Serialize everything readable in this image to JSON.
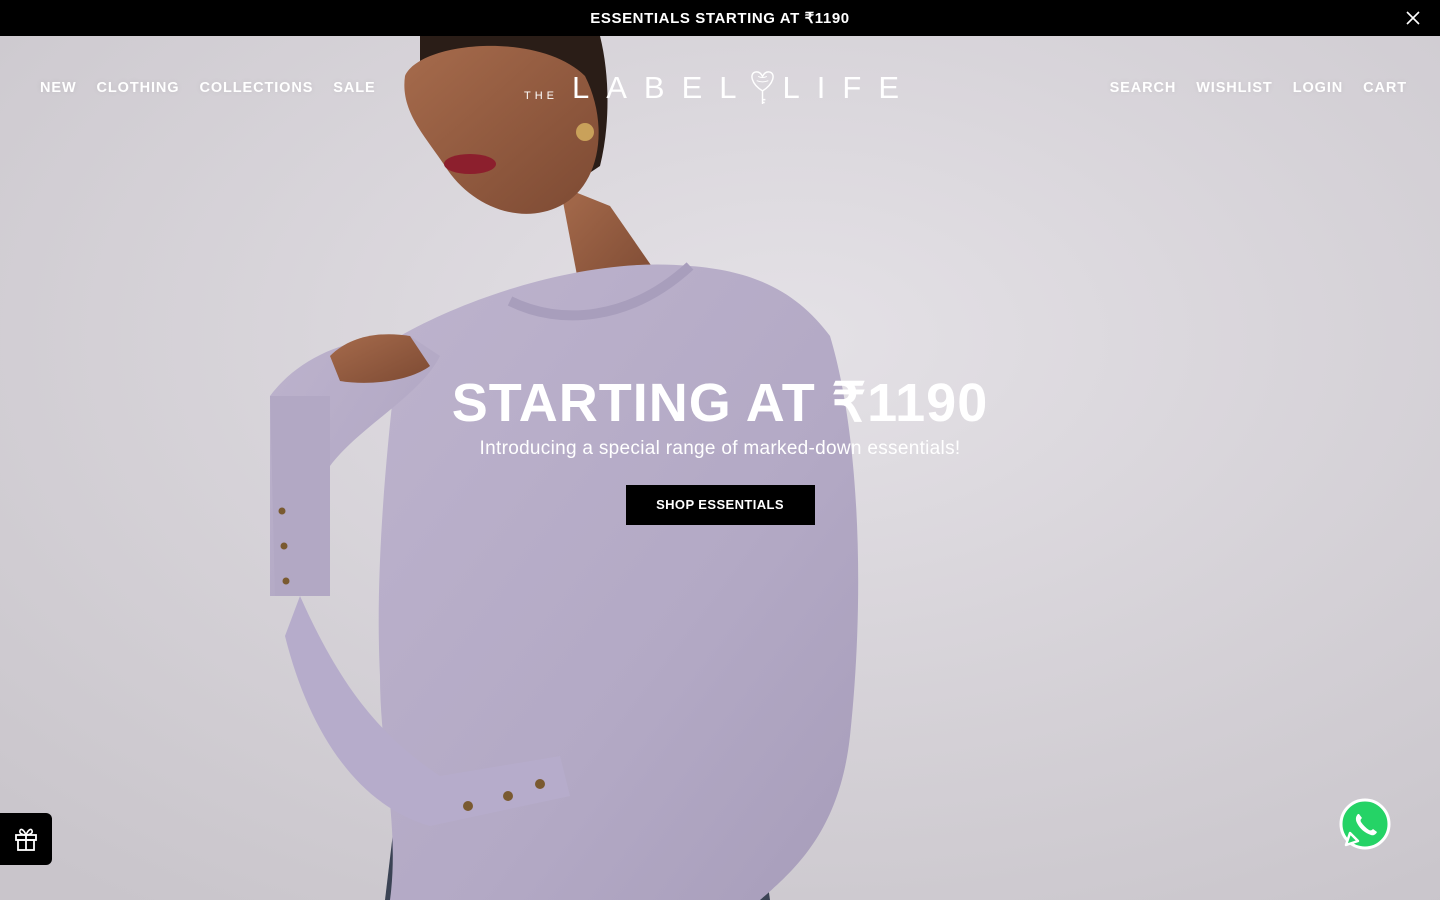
{
  "announcement": {
    "text": "ESSENTIALS STARTING AT ₹1190",
    "close_icon": "close-icon"
  },
  "nav": {
    "left": [
      "NEW",
      "CLOTHING",
      "COLLECTIONS",
      "SALE"
    ],
    "right": [
      "SEARCH",
      "WISHLIST",
      "LOGIN",
      "CART"
    ]
  },
  "logo": {
    "the": "THE",
    "label": "LABEL",
    "life": "LIFE"
  },
  "hero": {
    "title": "STARTING AT ₹1190",
    "subtitle": "Introducing a special range of marked-down essentials!",
    "cta": "SHOP ESSENTIALS"
  },
  "widgets": {
    "gift_icon": "gift-icon",
    "whatsapp_icon": "whatsapp-icon"
  },
  "colors": {
    "announcement_bg": "#000000",
    "cta_bg": "#000000",
    "sweater": "#b7adc9",
    "whatsapp": "#25d366"
  }
}
